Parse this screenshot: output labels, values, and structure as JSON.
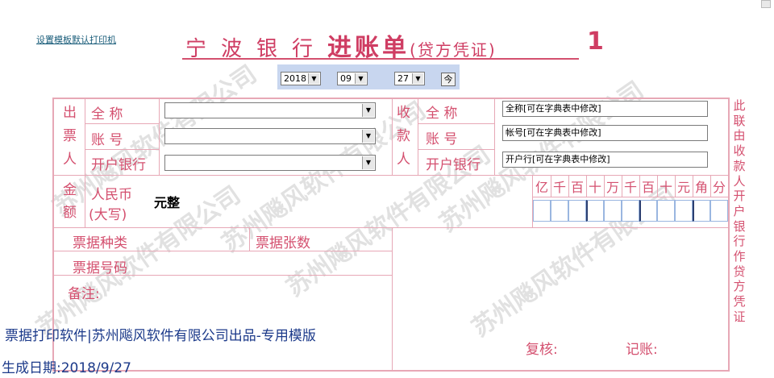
{
  "link": "设置模板默认打印机",
  "title": {
    "bank": "宁波银行",
    "doc": "进账单",
    "sub": "(贷方凭证)"
  },
  "page_no": "1",
  "date": {
    "year": "2018",
    "month": "09",
    "day": "27",
    "today_button": "今"
  },
  "payer": {
    "section_label": "出票人",
    "fullname_label": "全  称",
    "account_label": "账  号",
    "bank_label": "开户银行",
    "fullname": "",
    "account": "",
    "bank": ""
  },
  "payee": {
    "section_label": "收款人",
    "fullname_label": "全  称",
    "account_label": "账  号",
    "bank_label": "开户银行",
    "fullname": "全称[可在字典表中修改]",
    "account": "帐号[可在字典表中修改]",
    "bank": "开户行[可在字典表中修改]"
  },
  "amount": {
    "label": "金额",
    "rmb_label": "人民币",
    "rmb_sub": "(大写)",
    "words": "元整",
    "digits": [
      "亿",
      "千",
      "百",
      "十",
      "万",
      "千",
      "百",
      "十",
      "元",
      "角",
      "分"
    ]
  },
  "ticket": {
    "type_label": "票据种类",
    "count_label": "票据张数",
    "number_label": "票据号码"
  },
  "remark_label": "备注:",
  "review_label": "复核:",
  "bookkeep_label": "记账:",
  "side_text": "此联由收款人开户银行作贷方凭证",
  "watermark": "苏州飚风软件有限公司",
  "footer": {
    "line1": "票据打印软件|苏州飚风软件有限公司出品-专用模版",
    "line2": "生成日期:2018/9/27"
  },
  "colors": {
    "accent": "#d4506f",
    "footer": "#1c3a8a",
    "date_bar": "#c8d6ef"
  }
}
